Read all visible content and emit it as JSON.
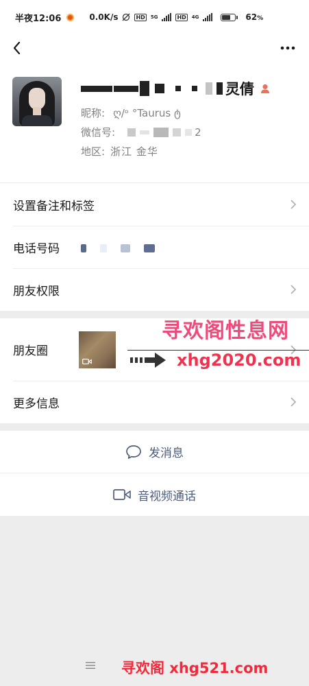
{
  "status_bar": {
    "time": "半夜12:06",
    "net_speed": "0.0K/s",
    "battery_percent": "62",
    "battery_suffix": "%",
    "network_1": "5G",
    "network_2": "4G",
    "battery_level": 0.62
  },
  "nav": {
    "back_icon": "chevron-left-icon",
    "more_icon": "more-icon"
  },
  "profile": {
    "name_visible_suffix": "灵倩",
    "nickname_label": "昵称:",
    "nickname_value": "ღ/ᵒ °Taurus ტ",
    "wechat_id_label": "微信号:",
    "wechat_id_visible_suffix": "2",
    "region_label": "地区:",
    "region_value": "浙江  金华",
    "gender_icon": "female-user-icon"
  },
  "menu": {
    "remark_tags": "设置备注和标签",
    "phone": "电话号码",
    "friend_permissions": "朋友权限",
    "moments": "朋友圈",
    "more_info": "更多信息"
  },
  "actions": {
    "send_message": "发消息",
    "video_call": "音视频通话"
  },
  "watermarks": {
    "top_title": "寻欢阁性息网",
    "top_url": "xhg2020.com",
    "bottom": "寻欢阁 xhg521.com"
  },
  "colors": {
    "link_blue": "#4c5c7b",
    "background": "#ededed",
    "watermark_red": "#f2293a",
    "gender_icon_color": "#e8735a"
  }
}
